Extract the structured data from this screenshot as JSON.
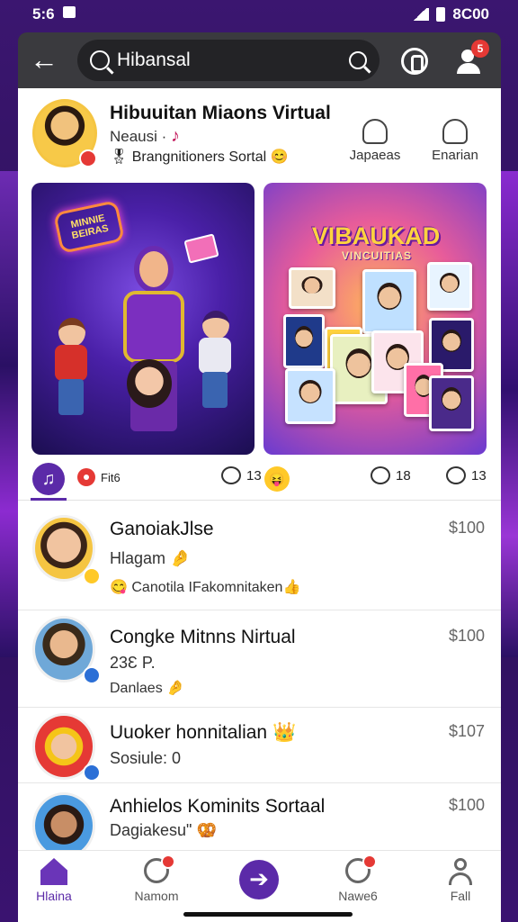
{
  "status_bar": {
    "time": "5:6",
    "right_text": "8C00"
  },
  "header": {
    "back_icon": "arrow-left-icon",
    "search_value": "Hibansal",
    "notification_badge": "5",
    "colors": {
      "bar": "#3a3a3e",
      "search": "#232326"
    }
  },
  "profile": {
    "name": "Hibuuitan Miaons Virtual",
    "subtitle": "Neausi ·",
    "tagline": "🎖 Brangnitioners Sortal 😊",
    "actions": [
      {
        "label": "Japaeas",
        "icon": "bell-icon"
      },
      {
        "label": "Enarian",
        "icon": "users-icon"
      }
    ]
  },
  "media": {
    "left_neon": "MINNIE BEIRAS",
    "right_title": "VIBAUKAD",
    "right_subtitle": "VINCUITIAS"
  },
  "actions_row": {
    "record_label": "Fit6",
    "comments": [
      "13",
      "18",
      "13"
    ]
  },
  "list": [
    {
      "title": "GanoiakJlse",
      "line2": "Hlagam 🤌",
      "line3": "😋 Canotila IFakomnitaken👍",
      "price": "$100"
    },
    {
      "title": "Congke Mitnns Nirtual",
      "line2": "23Ɛ P.",
      "line3": "Danlaes 🤌",
      "price": "$100"
    },
    {
      "title": "Uuoker honnitalian 👑",
      "line2": "Sosiule: 0",
      "price": "$107"
    },
    {
      "title": "Anhielos Kominits Sortaal",
      "line2": "Dagiakesu\" 🥨",
      "price": "$100"
    }
  ],
  "bottom_nav": {
    "items": [
      {
        "label": "Hlaina",
        "icon": "home-icon"
      },
      {
        "label": "Namom",
        "icon": "search-icon"
      },
      {
        "label": "",
        "icon": "arrow-right-icon"
      },
      {
        "label": "Nawe6",
        "icon": "chat-icon"
      },
      {
        "label": "Fall",
        "icon": "user-icon"
      }
    ],
    "accent": "#5b2aa8"
  }
}
